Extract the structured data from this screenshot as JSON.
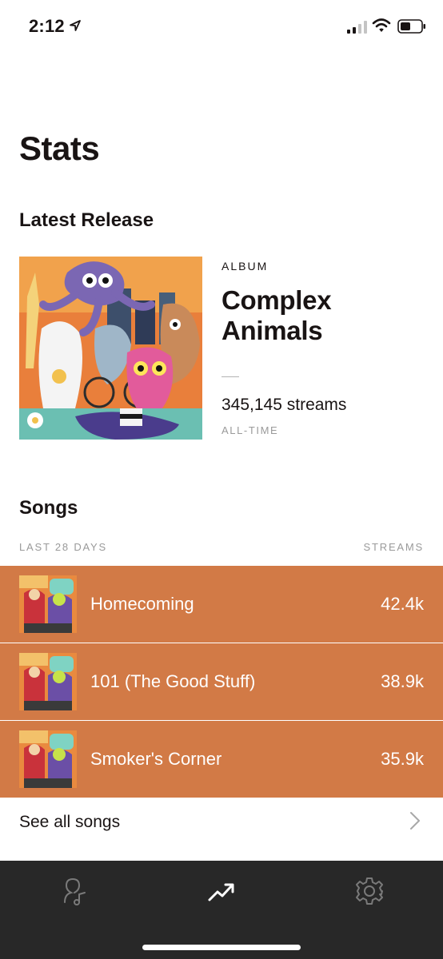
{
  "status_bar": {
    "time": "2:12",
    "icons": [
      "location-arrow-icon",
      "signal-icon",
      "wifi-icon",
      "battery-icon"
    ]
  },
  "page": {
    "title": "Stats"
  },
  "latest_release": {
    "section_title": "Latest Release",
    "type_label": "ALBUM",
    "name": "Complex Animals",
    "streams": "345,145 streams",
    "period": "ALL-TIME"
  },
  "songs": {
    "section_title": "Songs",
    "period_header": "LAST 28 DAYS",
    "streams_header": "STREAMS",
    "row_color": "#d27a46",
    "items": [
      {
        "name": "Homecoming",
        "streams": "42.4k"
      },
      {
        "name": "101 (The Good Stuff)",
        "streams": "38.9k"
      },
      {
        "name": "Smoker's Corner",
        "streams": "35.9k"
      }
    ],
    "see_all_label": "See all songs"
  },
  "tab_bar": {
    "background": "#282828",
    "tabs": [
      {
        "icon": "artist-icon",
        "active": false
      },
      {
        "icon": "stats-trend-icon",
        "active": true
      },
      {
        "icon": "settings-gear-icon",
        "active": false
      }
    ]
  }
}
